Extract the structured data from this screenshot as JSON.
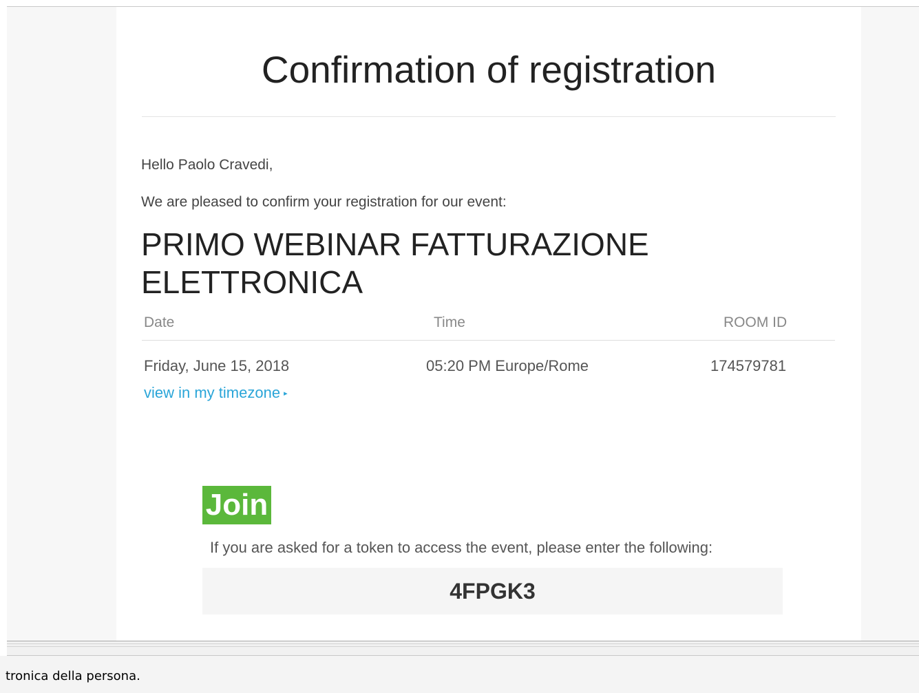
{
  "email": {
    "title": "Confirmation of registration",
    "greeting": "Hello Paolo Cravedi,",
    "intro": "We are pleased to confirm your registration for our event:",
    "event_name": "PRIMO WEBINAR FATTURAZIONE ELETTRONICA",
    "table": {
      "headers": {
        "date": "Date",
        "time": "Time",
        "room": "ROOM ID"
      },
      "row": {
        "date": "Friday, June 15, 2018",
        "time": "05:20 PM Europe/Rome",
        "room": "174579781"
      }
    },
    "timezone_link": "view in my timezone",
    "timezone_arrow": "▸",
    "join_label": "Join",
    "token_message": "If you are asked for a token to access the event, please enter the following:",
    "token": "4FPGK3"
  },
  "bottom_pane": {
    "text": "tronica della persona."
  },
  "colors": {
    "join_button": "#5bb83b",
    "link": "#2aa5d8",
    "token_box": "#f5f5f5"
  }
}
